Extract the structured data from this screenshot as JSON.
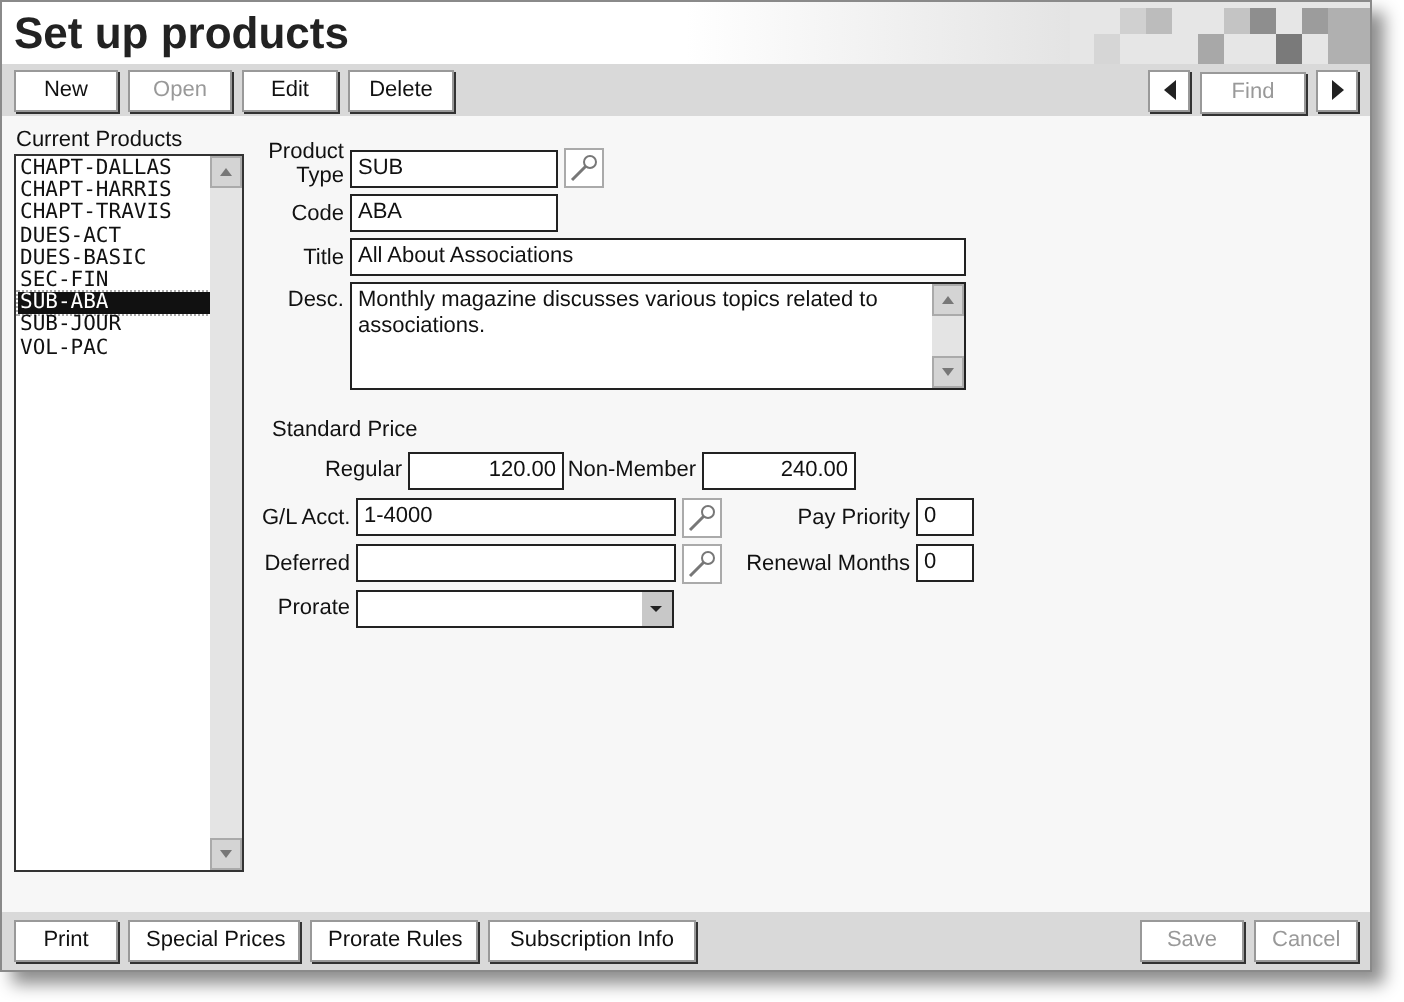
{
  "title": "Set up products",
  "toolbar": [
    {
      "label": "New",
      "disabled": false
    },
    {
      "label": "Open",
      "disabled": true
    },
    {
      "label": "Edit",
      "disabled": false
    },
    {
      "label": "Delete",
      "disabled": false
    }
  ],
  "find": {
    "label": "Find",
    "disabled": true
  },
  "product_list": {
    "label": "Current Products",
    "items": [
      {
        "label": "CHAPT-DALLAS",
        "selected": false
      },
      {
        "label": "CHAPT-HARRIS",
        "selected": false
      },
      {
        "label": "CHAPT-TRAVIS",
        "selected": false
      },
      {
        "label": "DUES-ACT",
        "selected": false
      },
      {
        "label": "DUES-BASIC",
        "selected": false
      },
      {
        "label": "SEC-FIN",
        "selected": false
      },
      {
        "label": "SUB-ABA",
        "selected": true
      },
      {
        "label": "SUB-JOUR",
        "selected": false
      },
      {
        "label": "VOL-PAC",
        "selected": false
      }
    ]
  },
  "form": {
    "product_type": {
      "label": "Product Type",
      "value": "SUB"
    },
    "code": {
      "label": "Code",
      "value": "ABA"
    },
    "title": {
      "label": "Title",
      "value": "All About Associations"
    },
    "desc": {
      "label": "Desc.",
      "value": "Monthly magazine discusses various topics related to associations."
    },
    "standard_price": {
      "label": "Standard Price",
      "regular": {
        "label": "Regular",
        "value": "120.00"
      },
      "non_member": {
        "label": "Non-Member",
        "value": "240.00"
      }
    },
    "gl_acct": {
      "label": "G/L Acct.",
      "value": "1-4000"
    },
    "pay_priority": {
      "label": "Pay Priority",
      "value": "0"
    },
    "deferred": {
      "label": "Deferred"
    },
    "renewal_months": {
      "label": "Renewal Months",
      "value": "0"
    },
    "prorate": {
      "label": "Prorate"
    }
  },
  "bottom_buttons": [
    {
      "label": "Print",
      "disabled": false
    },
    {
      "label": "Special Prices",
      "disabled": false
    },
    {
      "label": "Prorate Rules",
      "disabled": false
    },
    {
      "label": "Subscription Info",
      "disabled": false
    }
  ],
  "actions": [
    {
      "label": "Save",
      "disabled": true
    },
    {
      "label": "Cancel",
      "disabled": true
    }
  ]
}
